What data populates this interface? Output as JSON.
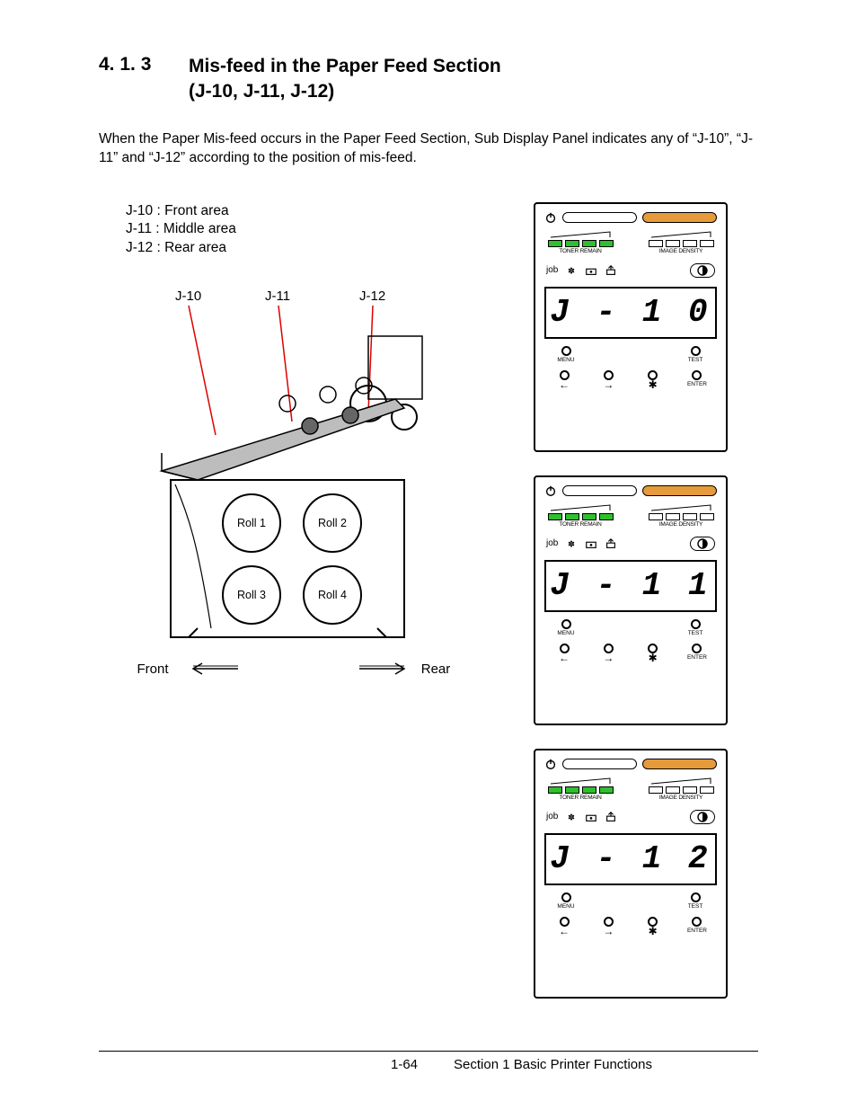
{
  "heading": {
    "number": "4. 1. 3",
    "title_line1": "Mis-feed in the Paper Feed Section",
    "title_line2": "(J-10, J-11, J-12)"
  },
  "paragraph": "When the Paper Mis-feed occurs in the Paper Feed Section, Sub Display Panel indicates any of “J-10”, “J-11” and “J-12” according to the position of mis-feed.",
  "legend": {
    "j10": "J-10 : Front area",
    "j11": "J-11 : Middle area",
    "j12": "J-12 : Rear area"
  },
  "diagram": {
    "labels": {
      "j10": "J-10",
      "j11": "J-11",
      "j12": "J-12"
    },
    "rolls": {
      "r1": "Roll 1",
      "r2": "Roll 2",
      "r3": "Roll 3",
      "r4": "Roll 4"
    },
    "front": "Front",
    "rear": "Rear"
  },
  "panel_common": {
    "toner_remain": "TONER REMAIN",
    "image_density": "IMAGE DENSITY",
    "job": "job",
    "menu": "MENU",
    "test": "TEST",
    "enter": "ENTER",
    "star": "✱",
    "arrow_left": "←",
    "arrow_right": "→"
  },
  "panels": [
    {
      "code": "J - 1 0"
    },
    {
      "code": "J - 1 1"
    },
    {
      "code": "J - 1 2"
    }
  ],
  "footer": {
    "page": "1-64",
    "section": "Section 1     Basic Printer Functions"
  }
}
